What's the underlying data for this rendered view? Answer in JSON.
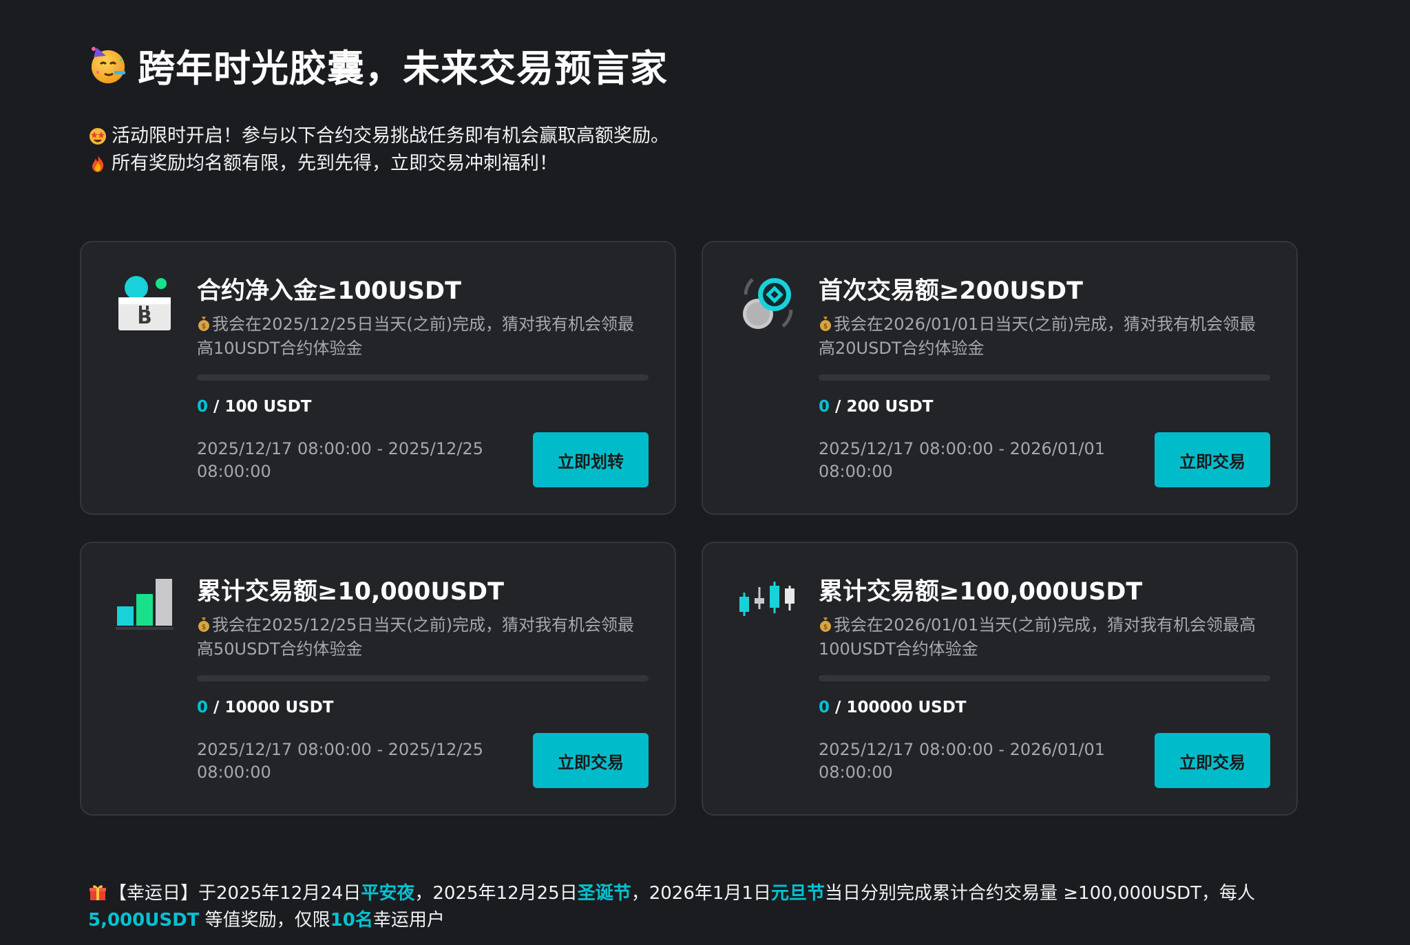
{
  "page": {
    "title": "跨年时光胶囊，未来交易预言家",
    "intro_lines": [
      "活动限时开启！参与以下合约交易挑战任务即有机会赢取高额奖励。",
      "所有奖励均名额有限，先到先得，立即交易冲刺福利！"
    ]
  },
  "colors": {
    "accent": "#00c2d1",
    "button_bg": "#00bcca",
    "card_bg": "#232428",
    "page_bg": "#1b1c1f",
    "muted_text": "#a6a8ad"
  },
  "tasks": [
    {
      "icon": "wallet-deposit-icon",
      "title": "合约净入金≥100USDT",
      "desc": "我会在2025/12/25日当天(之前)完成，猜对我有机会领最高10USDT合约体验金",
      "progress_current": "0",
      "progress_target": "/ 100 USDT",
      "progress_fraction": 0,
      "time_range": "2025/12/17 08:00:00 - 2025/12/25 08:00:00",
      "button": "立即划转"
    },
    {
      "icon": "coins-exchange-icon",
      "title": "首次交易额≥200USDT",
      "desc": "我会在2026/01/01日当天(之前)完成，猜对我有机会领最高20USDT合约体验金",
      "progress_current": "0",
      "progress_target": "/ 200 USDT",
      "progress_fraction": 0,
      "time_range": "2025/12/17 08:00:00 - 2026/01/01 08:00:00",
      "button": "立即交易"
    },
    {
      "icon": "bar-chart-icon",
      "title": "累计交易额≥10,000USDT",
      "desc": "我会在2025/12/25日当天(之前)完成，猜对我有机会领最高50USDT合约体验金",
      "progress_current": "0",
      "progress_target": "/ 10000 USDT",
      "progress_fraction": 0,
      "time_range": "2025/12/17 08:00:00 - 2025/12/25 08:00:00",
      "button": "立即交易"
    },
    {
      "icon": "candlestick-icon",
      "title": "累计交易额≥100,000USDT",
      "desc": "我会在2026/01/01当天(之前)完成，猜对我有机会领最高100USDT合约体验金",
      "progress_current": "0",
      "progress_target": "/ 100000 USDT",
      "progress_fraction": 0,
      "time_range": "2025/12/17 08:00:00 - 2026/01/01 08:00:00",
      "button": "立即交易"
    }
  ],
  "footer": {
    "p1": "【幸运日】于2025年12月24日",
    "h1": "平安夜",
    "p2": "，2025年12月25日",
    "h2": "圣诞节",
    "p3": "，2026年1月1日",
    "h3": "元旦节",
    "p4": "当日分别完成累计合约交易量 ≥100,000USDT，每人 ",
    "h4": "5,000USDT",
    "p5": " 等值奖励，仅限",
    "h5": "10名",
    "p6": "幸运用户"
  }
}
